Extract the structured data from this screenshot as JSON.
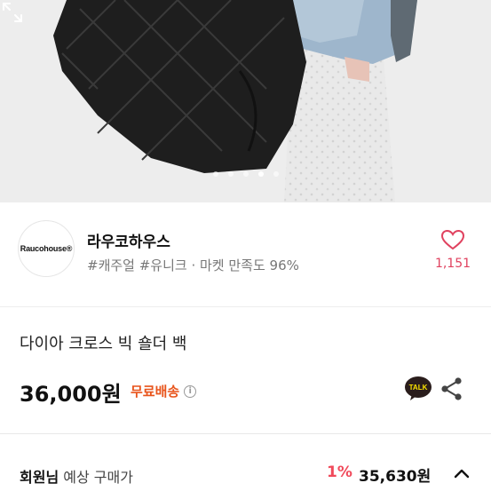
{
  "carousel": {
    "slide_count": 5,
    "active_index": 3
  },
  "store": {
    "logo_text": "Raucohouse®",
    "name": "라우코하우스",
    "meta": "#캐주얼 #유니크 · 마켓 만족도 96%",
    "like_count": "1,151"
  },
  "product": {
    "title": "다이아 크로스 빅 숄더 백",
    "price": "36,000원",
    "shipping_label": "무료배송",
    "talk_label": "TALK"
  },
  "member_price": {
    "label_bold": "회원님",
    "label_rest": " 예상 구매가",
    "discount": "1%",
    "price": "35,630원"
  },
  "colors": {
    "accent_pink": "#e0425f",
    "shipping_orange": "#e8541b",
    "discount_red": "#f04a5b"
  }
}
